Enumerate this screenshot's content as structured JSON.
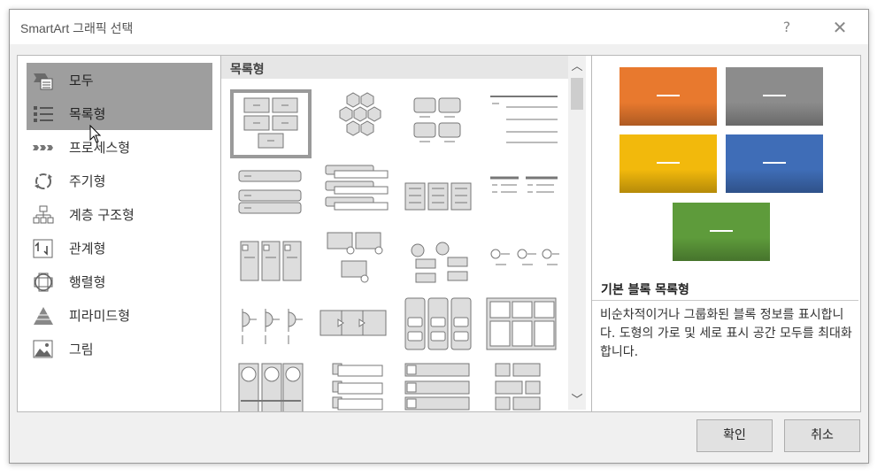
{
  "window": {
    "title": "SmartArt 그래픽 선택",
    "help_label": "?",
    "close_label": "✕"
  },
  "categories": [
    {
      "label": "모두",
      "icon": "all-icon",
      "selected": true
    },
    {
      "label": "목록형",
      "icon": "list-icon",
      "selected": true
    },
    {
      "label": "프로세스형",
      "icon": "process-icon",
      "selected": false
    },
    {
      "label": "주기형",
      "icon": "cycle-icon",
      "selected": false
    },
    {
      "label": "계층 구조형",
      "icon": "hierarchy-icon",
      "selected": false
    },
    {
      "label": "관계형",
      "icon": "relationship-icon",
      "selected": false
    },
    {
      "label": "행렬형",
      "icon": "matrix-icon",
      "selected": false
    },
    {
      "label": "피라미드형",
      "icon": "pyramid-icon",
      "selected": false
    },
    {
      "label": "그림",
      "icon": "picture-icon",
      "selected": false
    }
  ],
  "gallery": {
    "section_label": "목록형",
    "selected_index": 0,
    "scroll_up": "︿",
    "scroll_down": "﹀"
  },
  "preview": {
    "colors": [
      "#e8792e",
      "#8c8c8c",
      "#f2b90c",
      "#3f6db7",
      "#5e9b3b"
    ],
    "title": "기본 블록 목록형",
    "description": "비순차적이거나 그룹화된 블록 정보를 표시합니다. 도형의 가로 및 세로 표시 공간 모두를 최대화합니다."
  },
  "buttons": {
    "ok": "확인",
    "cancel": "취소"
  }
}
